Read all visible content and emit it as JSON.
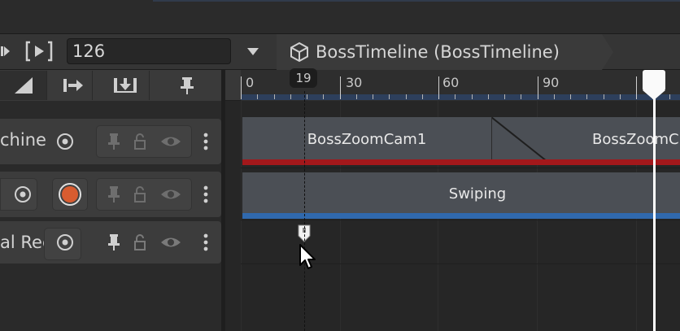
{
  "toolbar": {
    "frame_value": "126",
    "breadcrumb": "BossTimeline (BossTimeline)"
  },
  "ruler": {
    "labels": [
      "0",
      "30",
      "60",
      "90"
    ],
    "cursor_frame": "19"
  },
  "tracks": [
    {
      "name": "chine",
      "clips": [
        "BossZoomCam1",
        "BossZoomC"
      ]
    },
    {
      "name": "",
      "clips": [
        "Swiping"
      ]
    },
    {
      "name": "al Rec"
    }
  ],
  "colors": {
    "cinemachine_track": "#a3181b",
    "animation_track": "#3069ad",
    "record_button": "#d85c30"
  }
}
